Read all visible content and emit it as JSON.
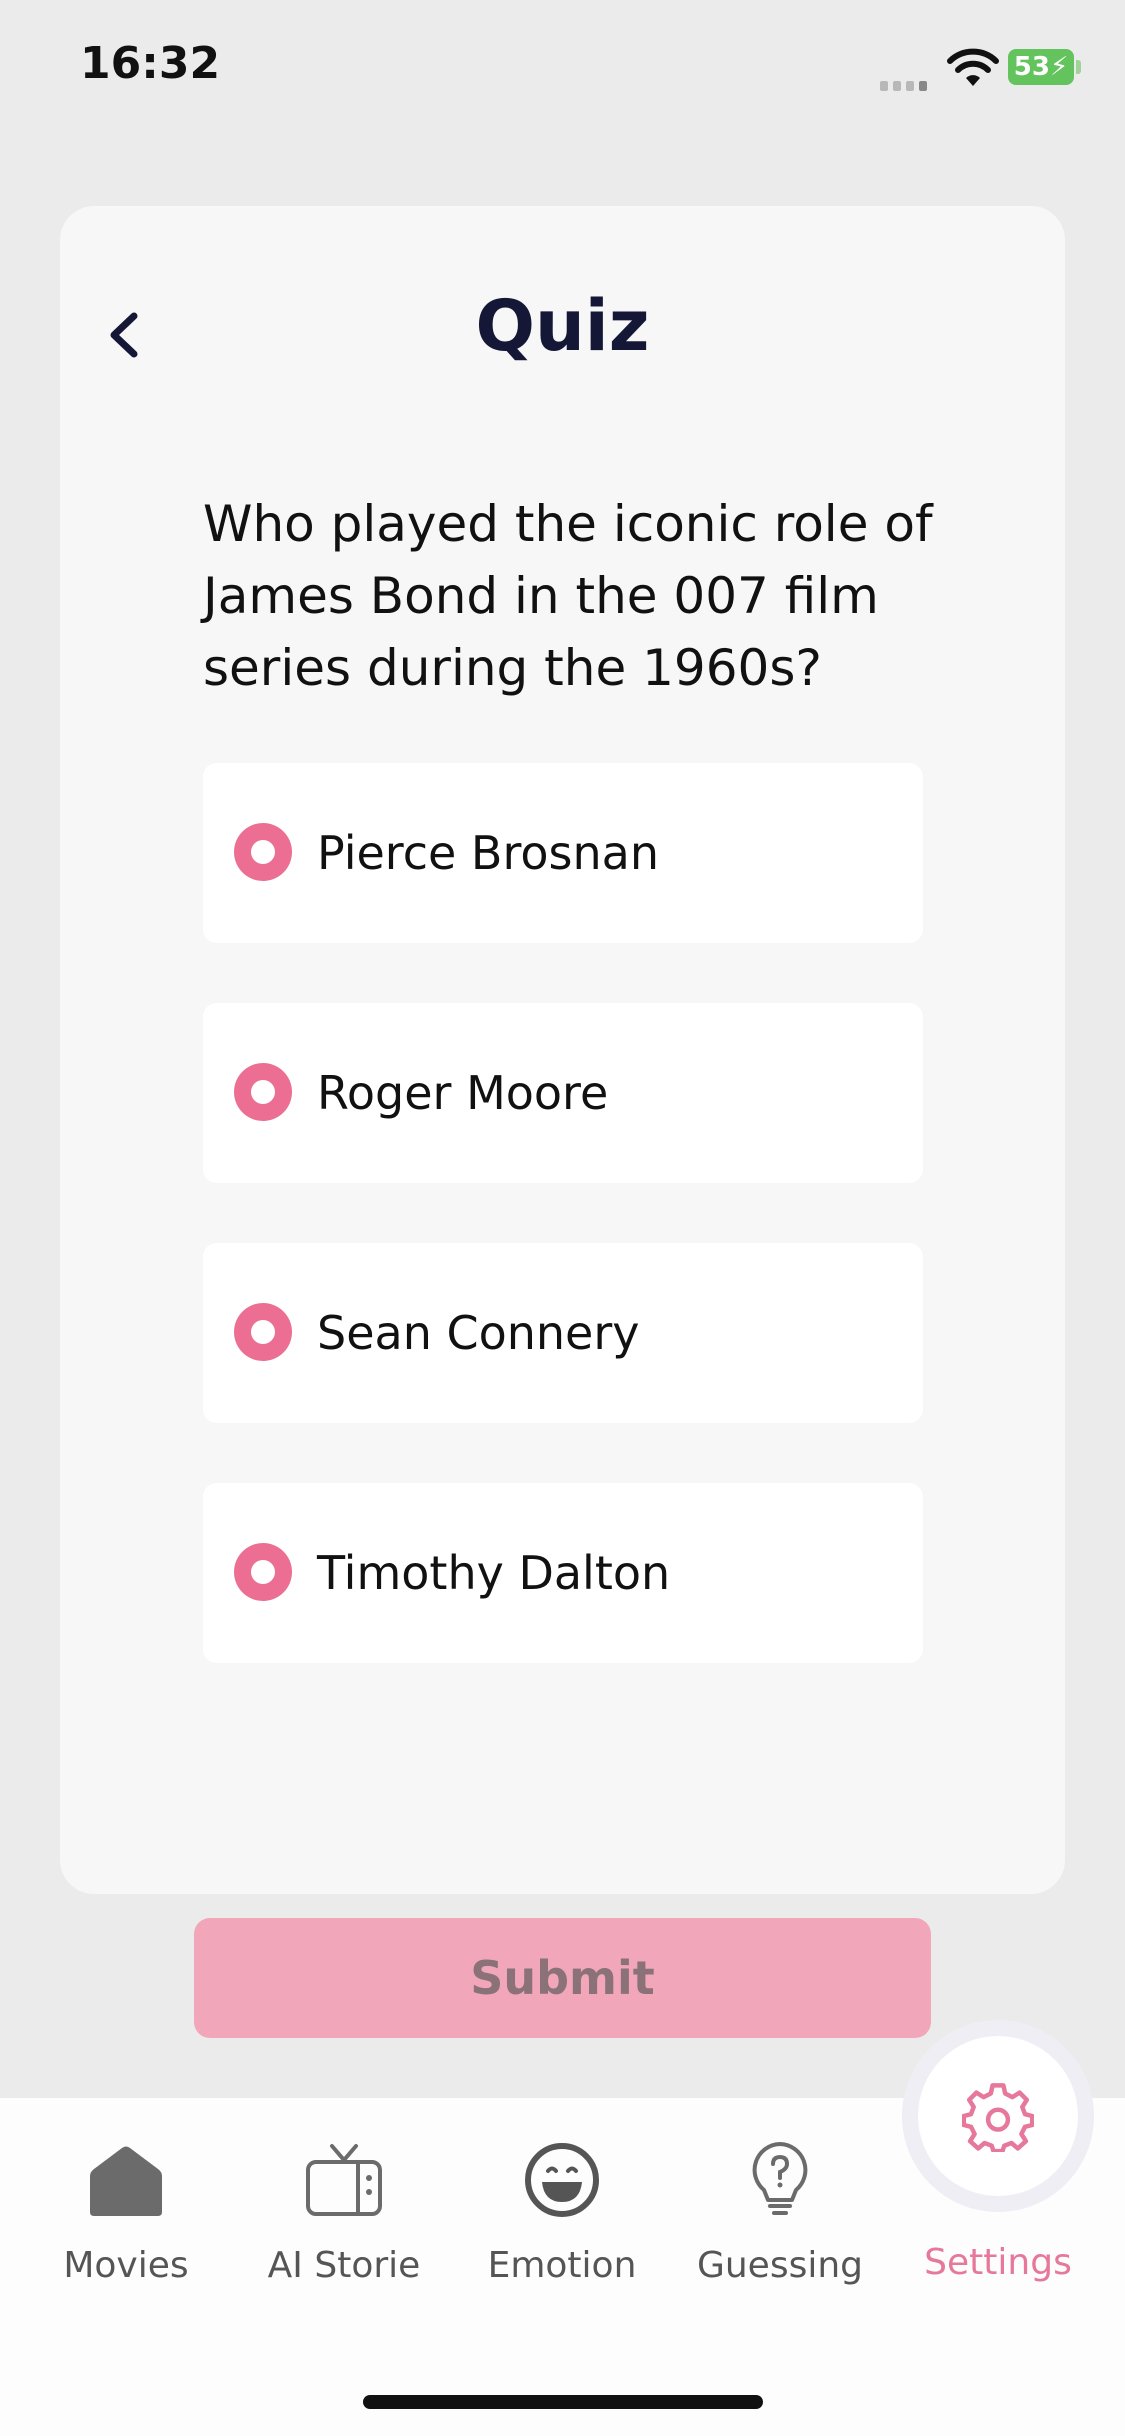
{
  "status_bar": {
    "time": "16:32",
    "battery": "53"
  },
  "header": {
    "title": "Quiz"
  },
  "quiz": {
    "question": "Who played the iconic role of James Bond in the 007 film series during the 1960s?",
    "options": [
      "Pierce Brosnan",
      "Roger Moore",
      "Sean Connery",
      "Timothy Dalton"
    ]
  },
  "submit_label": "Submit",
  "tabs": [
    {
      "label": "Movies",
      "icon": "home-icon"
    },
    {
      "label": "AI Storie",
      "icon": "tv-icon"
    },
    {
      "label": "Emotion",
      "icon": "laugh-face-icon"
    },
    {
      "label": "Guessing",
      "icon": "lightbulb-question-icon"
    },
    {
      "label": "Settings",
      "icon": "gear-icon"
    }
  ],
  "colors": {
    "accent": "#ec6e93",
    "submit_bg": "#f2a6ba",
    "title": "#141735"
  }
}
